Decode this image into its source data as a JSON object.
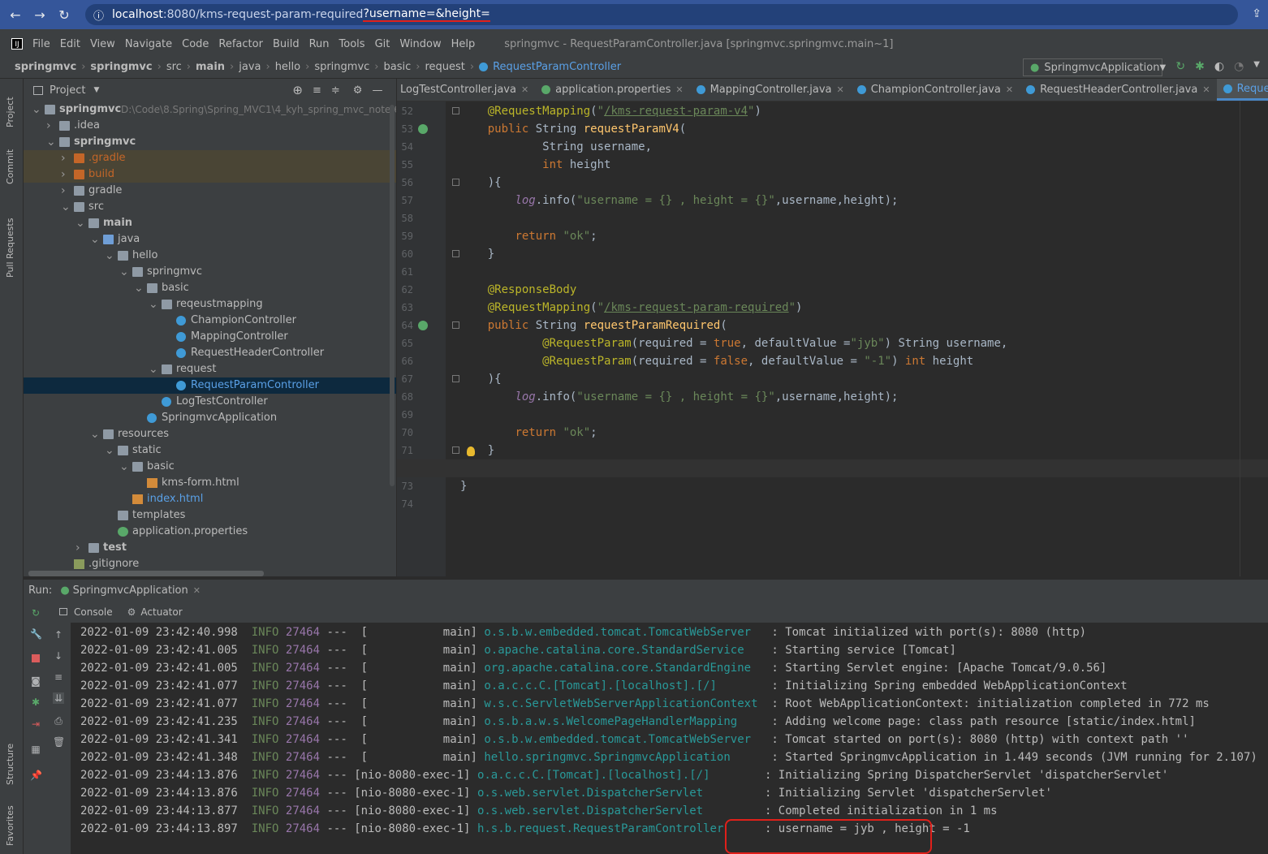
{
  "browser": {
    "back": "←",
    "forward": "→",
    "reload": "↻",
    "info": "ⓘ",
    "host": "localhost",
    "path": ":8080/kms-request-param-required",
    "query": "?username=&height="
  },
  "menu": {
    "items": [
      "File",
      "Edit",
      "View",
      "Navigate",
      "Code",
      "Refactor",
      "Build",
      "Run",
      "Tools",
      "Git",
      "Window",
      "Help"
    ],
    "window_title": "springmvc - RequestParamController.java [springmvc.springmvc.main~1]"
  },
  "breadcrumbs": [
    "springmvc",
    "springmvc",
    "src",
    "main",
    "java",
    "hello",
    "springmvc",
    "basic",
    "request",
    "RequestParamController"
  ],
  "run_config": "SpringmvcApplication",
  "side_tabs": [
    "Project",
    "Commit",
    "Pull Requests",
    "Structure",
    "Favorites"
  ],
  "project": {
    "header": "Project",
    "tree": [
      {
        "label": "springmvc",
        "note": "D:\\Code\\8.Spring\\Spring_MVC1\\4_kyh_spring_mvc_note\\6_S",
        "depth": 0,
        "arrow": "v",
        "icon": "folder",
        "bold": true
      },
      {
        "label": ".idea",
        "depth": 1,
        "arrow": ">",
        "icon": "folder"
      },
      {
        "label": "springmvc",
        "depth": 1,
        "arrow": "v",
        "icon": "folder",
        "bold": true
      },
      {
        "label": ".gradle",
        "depth": 2,
        "arrow": ">",
        "icon": "orange",
        "color": "#c46628",
        "hl": true
      },
      {
        "label": "build",
        "depth": 2,
        "arrow": ">",
        "icon": "orange",
        "color": "#c46628",
        "hl": true
      },
      {
        "label": "gradle",
        "depth": 2,
        "arrow": ">",
        "icon": "folder"
      },
      {
        "label": "src",
        "depth": 2,
        "arrow": "v",
        "icon": "folder"
      },
      {
        "label": "main",
        "depth": 3,
        "arrow": "v",
        "icon": "folder",
        "bold": true
      },
      {
        "label": "java",
        "depth": 4,
        "arrow": "v",
        "icon": "blue"
      },
      {
        "label": "hello",
        "depth": 5,
        "arrow": "v",
        "icon": "folder"
      },
      {
        "label": "springmvc",
        "depth": 6,
        "arrow": "v",
        "icon": "folder"
      },
      {
        "label": "basic",
        "depth": 7,
        "arrow": "v",
        "icon": "folder"
      },
      {
        "label": "reqeustmapping",
        "depth": 8,
        "arrow": "v",
        "icon": "folder"
      },
      {
        "label": "ChampionController",
        "depth": 9,
        "icon": "cls"
      },
      {
        "label": "MappingController",
        "depth": 9,
        "icon": "cls"
      },
      {
        "label": "RequestHeaderController",
        "depth": 9,
        "icon": "cls"
      },
      {
        "label": "request",
        "depth": 8,
        "arrow": "v",
        "icon": "folder"
      },
      {
        "label": "RequestParamController",
        "depth": 9,
        "icon": "cls",
        "selected": true,
        "color": "#5aa0e6"
      },
      {
        "label": "LogTestController",
        "depth": 8,
        "icon": "cls"
      },
      {
        "label": "SpringmvcApplication",
        "depth": 7,
        "icon": "cls"
      },
      {
        "label": "resources",
        "depth": 4,
        "arrow": "v",
        "icon": "folder"
      },
      {
        "label": "static",
        "depth": 5,
        "arrow": "v",
        "icon": "folder"
      },
      {
        "label": "basic",
        "depth": 6,
        "arrow": "v",
        "icon": "folder"
      },
      {
        "label": "kms-form.html",
        "depth": 7,
        "icon": "html"
      },
      {
        "label": "index.html",
        "depth": 6,
        "icon": "html",
        "color": "#5aa0e6"
      },
      {
        "label": "templates",
        "depth": 5,
        "icon": "folder"
      },
      {
        "label": "application.properties",
        "depth": 5,
        "icon": "prop"
      },
      {
        "label": "test",
        "depth": 3,
        "arrow": ">",
        "icon": "folder",
        "bold": true
      },
      {
        "label": ".gitignore",
        "depth": 2,
        "icon": "file"
      }
    ]
  },
  "tabs": [
    {
      "label": "LogTestController.java",
      "icon": "none"
    },
    {
      "label": "application.properties",
      "icon": "prop"
    },
    {
      "label": "MappingController.java",
      "icon": "cls"
    },
    {
      "label": "ChampionController.java",
      "icon": "cls"
    },
    {
      "label": "RequestHeaderController.java",
      "icon": "cls"
    },
    {
      "label": "RequestParamController.java",
      "icon": "cls",
      "active": true
    }
  ],
  "code": [
    {
      "n": "52",
      "html": "    <span class=\"a\">@RequestMapping</span>(<span class=\"s\">\"</span><span class=\"u\">/kms-request-param-v4</span><span class=\"s\">\"</span>)"
    },
    {
      "n": "53",
      "html": "    <span class=\"k\">public</span> String <span class=\"m\">requestParamV4</span>(",
      "mark": true
    },
    {
      "n": "54",
      "html": "            String username,"
    },
    {
      "n": "55",
      "html": "            <span class=\"k\">int</span> height"
    },
    {
      "n": "56",
      "html": "    ){"
    },
    {
      "n": "57",
      "html": "        <span class=\"i\">log</span>.info(<span class=\"s\">\"username = {} , height = {}\"</span>,username,height);"
    },
    {
      "n": "58",
      "html": ""
    },
    {
      "n": "59",
      "html": "        <span class=\"k\">return</span> <span class=\"s\">\"ok\"</span>;"
    },
    {
      "n": "60",
      "html": "    }"
    },
    {
      "n": "61",
      "html": ""
    },
    {
      "n": "62",
      "html": "    <span class=\"a\">@ResponseBody</span>"
    },
    {
      "n": "63",
      "html": "    <span class=\"a\">@RequestMapping</span>(<span class=\"s\">\"</span><span class=\"u\">/kms-request-param-required</span><span class=\"s\">\"</span>)"
    },
    {
      "n": "64",
      "html": "    <span class=\"k\">public</span> String <span class=\"m\">requestParamRequired</span>(",
      "mark": true
    },
    {
      "n": "65",
      "html": "            <span class=\"a\">@RequestParam</span>(required = <span class=\"k\">true</span>, defaultValue =<span class=\"s\">\"jyb\"</span>) String username,"
    },
    {
      "n": "66",
      "html": "            <span class=\"a\">@RequestParam</span>(required = <span class=\"k\">false</span>, defaultValue = <span class=\"s\">\"-1\"</span>) <span class=\"k\">int</span> height"
    },
    {
      "n": "67",
      "html": "    ){"
    },
    {
      "n": "68",
      "html": "        <span class=\"i\">log</span>.info(<span class=\"s\">\"username = {} , height = {}\"</span>,username,height);"
    },
    {
      "n": "69",
      "html": ""
    },
    {
      "n": "70",
      "html": "        <span class=\"k\">return</span> <span class=\"s\">\"ok\"</span>;"
    },
    {
      "n": "71",
      "html": "    }"
    },
    {
      "n": "72",
      "html": "",
      "cur": true
    },
    {
      "n": "73",
      "html": "}"
    },
    {
      "n": "74",
      "html": ""
    }
  ],
  "run": {
    "label": "Run:",
    "config": "SpringmvcApplication",
    "console_tab": "Console",
    "actuator_tab": "Actuator"
  },
  "logs": [
    {
      "ts": "2022-01-09 23:42:40.998",
      "lvl": "INFO",
      "pid": "27464",
      "thr": "---  [           main]",
      "logger": "o.s.b.w.embedded.tomcat.TomcatWebServer  ",
      "msg": ": Tomcat initialized with port(s): 8080 (http)"
    },
    {
      "ts": "2022-01-09 23:42:41.005",
      "lvl": "INFO",
      "pid": "27464",
      "thr": "---  [           main]",
      "logger": "o.apache.catalina.core.StandardService   ",
      "msg": ": Starting service [Tomcat]"
    },
    {
      "ts": "2022-01-09 23:42:41.005",
      "lvl": "INFO",
      "pid": "27464",
      "thr": "---  [           main]",
      "logger": "org.apache.catalina.core.StandardEngine  ",
      "msg": ": Starting Servlet engine: [Apache Tomcat/9.0.56]"
    },
    {
      "ts": "2022-01-09 23:42:41.077",
      "lvl": "INFO",
      "pid": "27464",
      "thr": "---  [           main]",
      "logger": "o.a.c.c.C.[Tomcat].[localhost].[/]       ",
      "msg": ": Initializing Spring embedded WebApplicationContext"
    },
    {
      "ts": "2022-01-09 23:42:41.077",
      "lvl": "INFO",
      "pid": "27464",
      "thr": "---  [           main]",
      "logger": "w.s.c.ServletWebServerApplicationContext ",
      "msg": ": Root WebApplicationContext: initialization completed in 772 ms"
    },
    {
      "ts": "2022-01-09 23:42:41.235",
      "lvl": "INFO",
      "pid": "27464",
      "thr": "---  [           main]",
      "logger": "o.s.b.a.w.s.WelcomePageHandlerMapping    ",
      "msg": ": Adding welcome page: class path resource [static/index.html]"
    },
    {
      "ts": "2022-01-09 23:42:41.341",
      "lvl": "INFO",
      "pid": "27464",
      "thr": "---  [           main]",
      "logger": "o.s.b.w.embedded.tomcat.TomcatWebServer  ",
      "msg": ": Tomcat started on port(s): 8080 (http) with context path ''"
    },
    {
      "ts": "2022-01-09 23:42:41.348",
      "lvl": "INFO",
      "pid": "27464",
      "thr": "---  [           main]",
      "logger": "hello.springmvc.SpringmvcApplication     ",
      "msg": ": Started SpringmvcApplication in 1.449 seconds (JVM running for 2.107)"
    },
    {
      "ts": "2022-01-09 23:44:13.876",
      "lvl": "INFO",
      "pid": "27464",
      "thr": "--- [nio-8080-exec-1]",
      "logger": "o.a.c.c.C.[Tomcat].[localhost].[/]       ",
      "msg": ": Initializing Spring DispatcherServlet 'dispatcherServlet'"
    },
    {
      "ts": "2022-01-09 23:44:13.876",
      "lvl": "INFO",
      "pid": "27464",
      "thr": "--- [nio-8080-exec-1]",
      "logger": "o.s.web.servlet.DispatcherServlet        ",
      "msg": ": Initializing Servlet 'dispatcherServlet'"
    },
    {
      "ts": "2022-01-09 23:44:13.877",
      "lvl": "INFO",
      "pid": "27464",
      "thr": "--- [nio-8080-exec-1]",
      "logger": "o.s.web.servlet.DispatcherServlet        ",
      "msg": ": Completed initialization in 1 ms"
    },
    {
      "ts": "2022-01-09 23:44:13.897",
      "lvl": "INFO",
      "pid": "27464",
      "thr": "--- [nio-8080-exec-1]",
      "logger": "h.s.b.request.RequestParamController     ",
      "msg": ": username = jyb , height = -1"
    }
  ]
}
